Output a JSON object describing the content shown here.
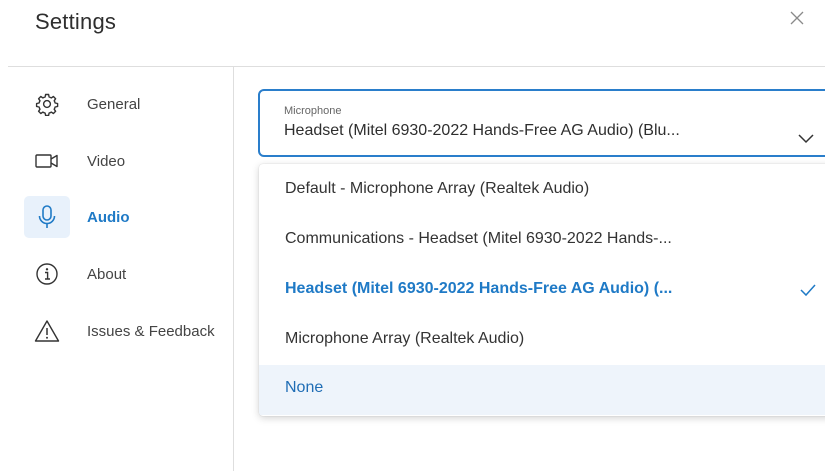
{
  "dialog": {
    "title": "Settings",
    "close_icon": "close-icon"
  },
  "sidebar": {
    "items": [
      {
        "label": "General",
        "icon": "gear-icon",
        "active": false
      },
      {
        "label": "Video",
        "icon": "video-camera-icon",
        "active": false
      },
      {
        "label": "Audio",
        "icon": "microphone-icon",
        "active": true
      },
      {
        "label": "About",
        "icon": "info-icon",
        "active": false
      },
      {
        "label": "Issues & Feedback",
        "icon": "warning-icon",
        "active": false
      }
    ]
  },
  "microphone": {
    "label": "Microphone",
    "value": "Headset (Mitel 6930-2022 Hands-Free AG Audio) (Blu...",
    "chevron_icon": "chevron-down-icon",
    "options": [
      {
        "label": "Default - Microphone Array (Realtek Audio)",
        "selected": false,
        "hovered": false
      },
      {
        "label": "Communications - Headset (Mitel 6930-2022 Hands-...",
        "selected": false,
        "hovered": false
      },
      {
        "label": "Headset (Mitel 6930-2022 Hands-Free AG Audio) (...",
        "selected": true,
        "hovered": false
      },
      {
        "label": "Microphone Array (Realtek Audio)",
        "selected": false,
        "hovered": false
      },
      {
        "label": "None",
        "selected": false,
        "hovered": true
      }
    ],
    "check_icon": "checkmark-icon"
  },
  "colors": {
    "accent": "#1f7ac6",
    "active_bg": "#e8f1fb",
    "hover_bg": "#eef4fb",
    "border": "#2a7ecb",
    "divider": "#dedede"
  }
}
